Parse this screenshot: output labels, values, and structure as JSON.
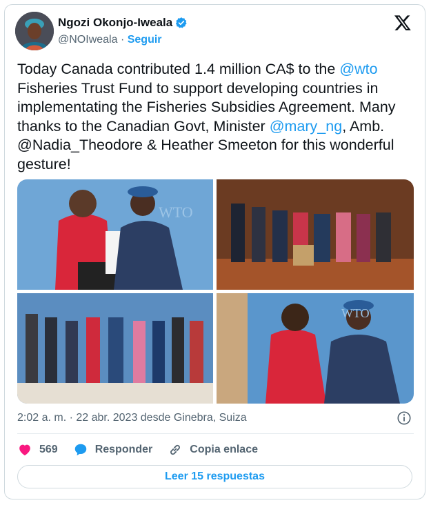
{
  "author": {
    "name": "Ngozi Okonjo-Iweala",
    "handle": "@NOIweala",
    "separator": "·",
    "follow_label": "Seguir"
  },
  "tweet": {
    "segments": [
      {
        "text": "Today Canada contributed 1.4 million CA$ to the ",
        "type": "text"
      },
      {
        "text": "@wto",
        "type": "mention"
      },
      {
        "text": " Fisheries Trust Fund to support developing countries in implementating the Fisheries Subsidies Agreement. Many thanks to the Canadian Govt, Minister ",
        "type": "text"
      },
      {
        "text": "@mary_ng",
        "type": "mention"
      },
      {
        "text": ", Amb. @Nadia_Theodore & Heather Smeeton for this wonderful gesture!",
        "type": "text"
      }
    ]
  },
  "photos": {
    "wto_label": "WTO"
  },
  "meta": {
    "timestamp": "2:02 a. m. · 22 abr. 2023 desde Ginebra, Suiza"
  },
  "actions": {
    "like_count": "569",
    "reply_label": "Responder",
    "copy_label": "Copia enlace"
  },
  "read_replies_label": "Leer 15 respuestas",
  "colors": {
    "accent": "#1d9bf0",
    "like": "#f91880",
    "muted": "#536471"
  }
}
